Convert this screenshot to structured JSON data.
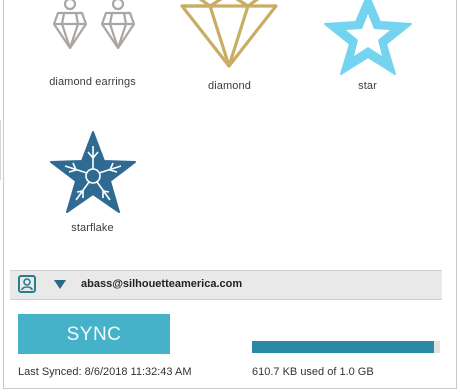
{
  "library": {
    "items": [
      {
        "label": "diamond earrings",
        "icon": "diamond-earrings-icon",
        "color": "#a9a6a3"
      },
      {
        "label": "diamond",
        "icon": "diamond-icon",
        "color": "#c9ad62"
      },
      {
        "label": "star",
        "icon": "star-icon",
        "color": "#74d4ef"
      },
      {
        "label": "starflake",
        "icon": "starflake-icon",
        "color": "#2f6a93"
      }
    ]
  },
  "account": {
    "email": "abass@silhouetteamerica.com",
    "avatar_icon": "user-icon",
    "menu_icon": "chevron-down-icon"
  },
  "sync": {
    "button_label": "SYNC",
    "last_synced": "Last Synced: 8/6/2018 11:32:43 AM",
    "storage_text": "610.7 KB used of 1.0 GB",
    "storage_fraction": 0.97,
    "accent_color": "#45b2ca"
  }
}
